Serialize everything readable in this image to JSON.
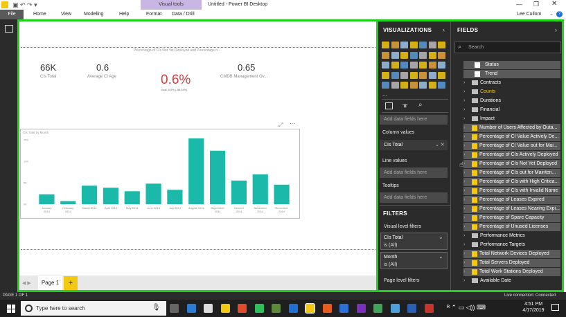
{
  "title_bar": {
    "context_tab": "Visual tools",
    "doc_title": "Untitled - Power BI Desktop",
    "user": "Lee Cullom"
  },
  "menu": [
    "File",
    "Home",
    "View",
    "Modeling",
    "Help",
    "Format",
    "Data / Drill"
  ],
  "cards": [
    {
      "value": "66K",
      "label": "CIs Total"
    },
    {
      "value": "0.6",
      "label": "Average CI Age"
    },
    {
      "value": "0.65",
      "label": "CMDB Management Ov..."
    }
  ],
  "kpi": {
    "title": "Percentage of CIs Not Yet Deployed and Percentage o...",
    "value": "0.6%",
    "goal": "Goal: 5.0% (-88.04%)"
  },
  "chart_data": {
    "type": "bar",
    "title": "CIs Total by Month",
    "categories": [
      "January 2014",
      "February 2014",
      "March 2014",
      "April 2014",
      "May 2014",
      "June 2014",
      "July 2014",
      "August 2014",
      "September 2014",
      "October 2014",
      "November 2014",
      "December 2014"
    ],
    "values": [
      4.8,
      1.5,
      9.0,
      8.0,
      6.3,
      10.0,
      7.0,
      32.0,
      26.0,
      11.5,
      14.5,
      9.5
    ],
    "yticks": [
      "15K",
      "10K",
      "5K",
      "0K"
    ],
    "ylim": [
      0,
      33
    ],
    "color": "#1bb9a9"
  },
  "pages": {
    "current": "Page 1",
    "add": "+",
    "status": "PAGE 1 OF 1",
    "connection": "Live connection: Connected"
  },
  "visualizations": {
    "title": "VISUALIZATIONS",
    "wells": [
      {
        "label": "",
        "value": "Add data fields here"
      },
      {
        "label": "Column values",
        "value": "CIs Total"
      },
      {
        "label": "Line values",
        "value": "Add data fields here"
      },
      {
        "label": "Tooltips",
        "value": "Add data fields here"
      }
    ],
    "more": "..."
  },
  "filters": {
    "title": "FILTERS",
    "visual_level": "Visual level filters",
    "items": [
      {
        "name": "CIs Total",
        "value": "is (All)"
      },
      {
        "name": "Month",
        "value": "is (All)"
      }
    ],
    "page_level": "Page level filters"
  },
  "fields": {
    "title": "FIELDS",
    "search_placeholder": "Search",
    "items": [
      {
        "type": "check",
        "label": "Status"
      },
      {
        "type": "check",
        "label": "Trend"
      },
      {
        "type": "folder",
        "label": "Contracts"
      },
      {
        "type": "folder",
        "label": "Counts",
        "highlight": "#f2c811"
      },
      {
        "type": "folder",
        "label": "Durations"
      },
      {
        "type": "folder",
        "label": "Financial"
      },
      {
        "type": "folder",
        "label": "Impact"
      },
      {
        "type": "measure",
        "label": "Number of Users Affected by Outa..."
      },
      {
        "type": "measure",
        "label": "Percentage of CI Value Actively De..."
      },
      {
        "type": "measure",
        "label": "Percentage of CI Value out for Mai..."
      },
      {
        "type": "measure",
        "label": "Percentage of CIs Actively Deployed"
      },
      {
        "type": "measure",
        "label": "Percentage of CIs Not Yet Deployed"
      },
      {
        "type": "measure",
        "label": "Percentage of CIs out for Mainten..."
      },
      {
        "type": "measure",
        "label": "Percentage of CIs with High Critica..."
      },
      {
        "type": "measure",
        "label": "Percentage of CIs with Invalid Name"
      },
      {
        "type": "measure",
        "label": "Percentage of Leases Expired"
      },
      {
        "type": "measure",
        "label": "Percentage of Leases Nearing Expi..."
      },
      {
        "type": "measure",
        "label": "Percentage of Spare Capacity"
      },
      {
        "type": "measure",
        "label": "Percentage of Unused Licenses"
      },
      {
        "type": "folder",
        "label": "Performance Metrics"
      },
      {
        "type": "folder",
        "label": "Performance Targets"
      },
      {
        "type": "measure",
        "label": "Total Network Devices Deployed"
      },
      {
        "type": "measure",
        "label": "Total Servers Deployed"
      },
      {
        "type": "measure",
        "label": "Total Work Stations Deployed"
      },
      {
        "type": "table",
        "label": "Available Date"
      }
    ]
  },
  "taskbar": {
    "search_placeholder": "Type here to search",
    "time": "4:51 PM",
    "date": "4/17/2019"
  }
}
